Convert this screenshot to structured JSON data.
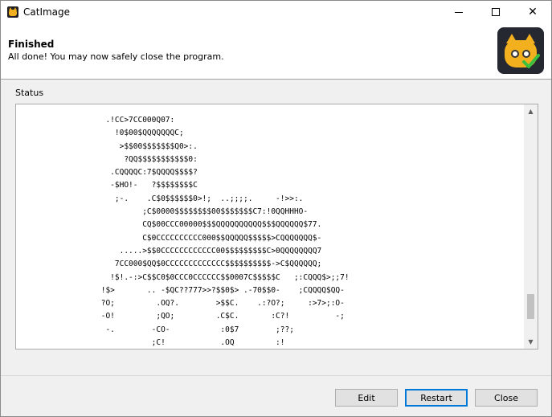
{
  "window": {
    "title": "CatImage"
  },
  "header": {
    "title": "Finished",
    "subtitle": "All done! You may now safely close the program."
  },
  "status": {
    "label": "Status",
    "log_lines": [
      "  .!CC>7CC000Q07:",
      "    !0$00$QQQQQQQC;",
      "     >$$00$$$$$$$Q0>:.",
      "      ?QQ$$$$$$$$$$$0:",
      "   .CQQQQC:7$QQQQ$$$$?",
      "   -$HO!-   ?$$$$$$$$C",
      "    ;-.    .C$0$$$$$$0>!;  ..;;;;.     -!>>:.",
      "          ;C$0000$$$$$$$$00$$$$$$$C7:!0QQHHHO-",
      "          CQ$00CCC00000$$$QQQQQQQQQQ$$$QQQQQQ$77.",
      "          C$0CCCCCCCCCC000$$QQQQQ$$$$$>CQQQQQQQ$-",
      "     .....>$$0CCCCCCCCCCCC00$$$$$$$$$C>0QQQQQQQQ7",
      "    7CC000$QQ$0CCCCCCCCCCCCC$$$$$$$$$$->C$QQQQQQ;",
      "   !$!.-:>C$$C0$0CCC0CCCCCC$$0007C$$$$$C   ;:CQQQ$>;;7!",
      " !$>       .. -$QC??777>>?$$0$> .-70$$0-    ;CQQQQ$QQ-",
      " ?O;         .OQ?.        >$$C.    .:?O?;     :>7>;:O-",
      " -O!         ;QO;         .C$C.       :C?!          -;",
      "  -.        -CO-           :0$7        ;??;",
      "            ;C!            .OQ         :!"
    ]
  },
  "buttons": {
    "edit": "Edit",
    "restart": "Restart",
    "close": "Close"
  }
}
